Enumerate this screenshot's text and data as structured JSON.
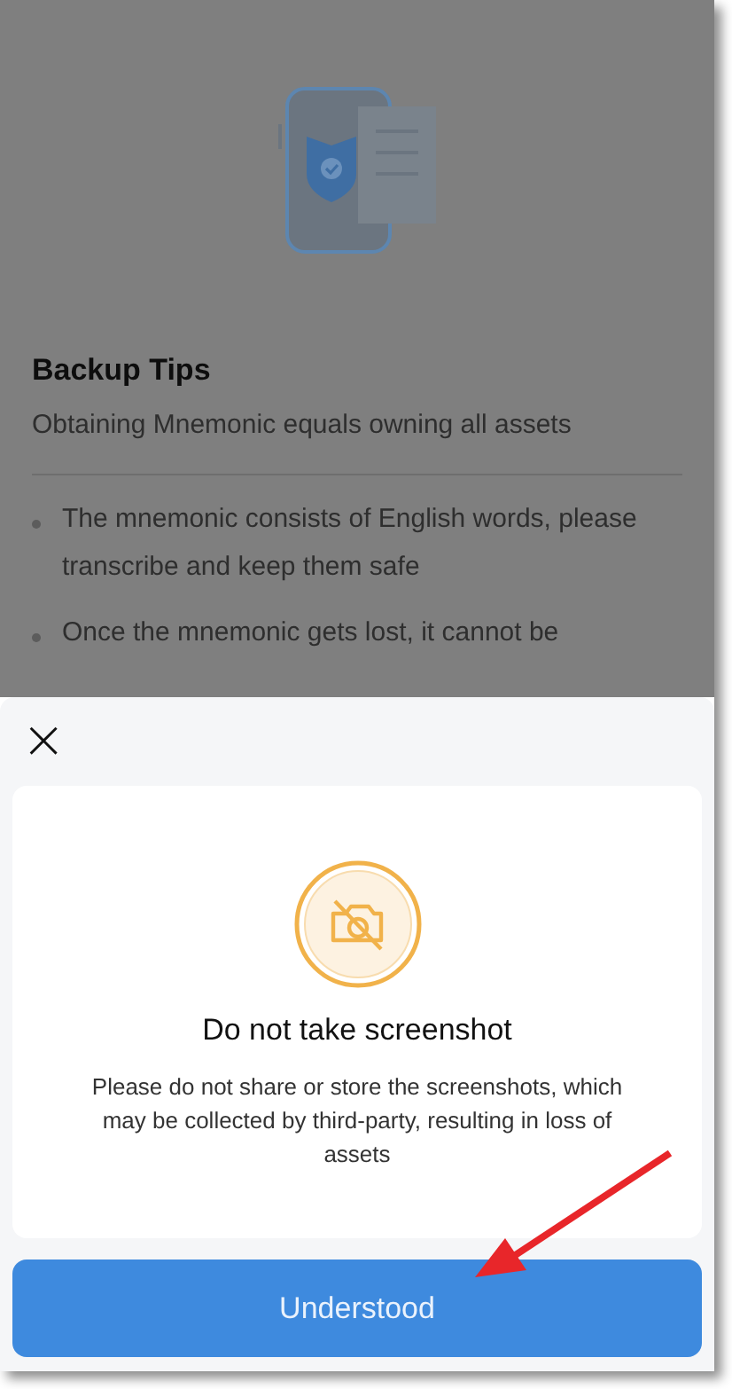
{
  "background_page": {
    "title": "Backup Tips",
    "subtitle": "Obtaining Mnemonic equals owning all assets",
    "tips": [
      "The mnemonic consists of English words, please transcribe and keep them safe",
      "Once the mnemonic gets lost, it cannot be"
    ]
  },
  "sheet": {
    "close_icon": "×",
    "title": "Do not take screenshot",
    "message": "Please do not share or store the screenshots, which may be collected by third-party, resulting in loss of assets",
    "button": "Understood"
  }
}
